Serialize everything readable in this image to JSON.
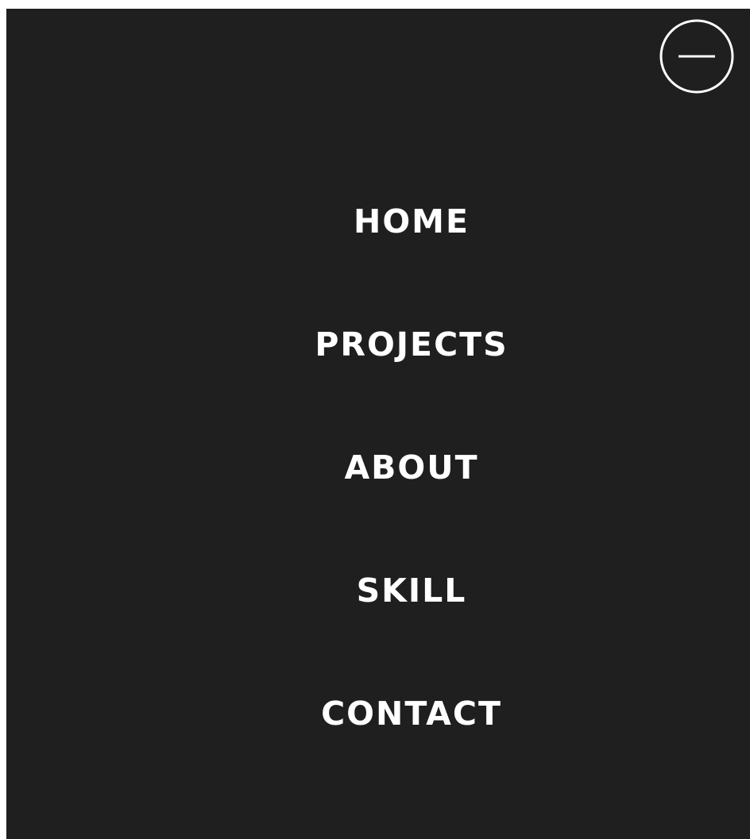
{
  "theme": {
    "panel_bg": "#1f1f1f",
    "text_color": "#ffffff"
  },
  "close_button": {
    "icon": "minus-circle-icon"
  },
  "nav": {
    "items": [
      {
        "label": "HOME"
      },
      {
        "label": "PROJECTS"
      },
      {
        "label": "ABOUT"
      },
      {
        "label": "SKILL"
      },
      {
        "label": "CONTACT"
      }
    ]
  }
}
